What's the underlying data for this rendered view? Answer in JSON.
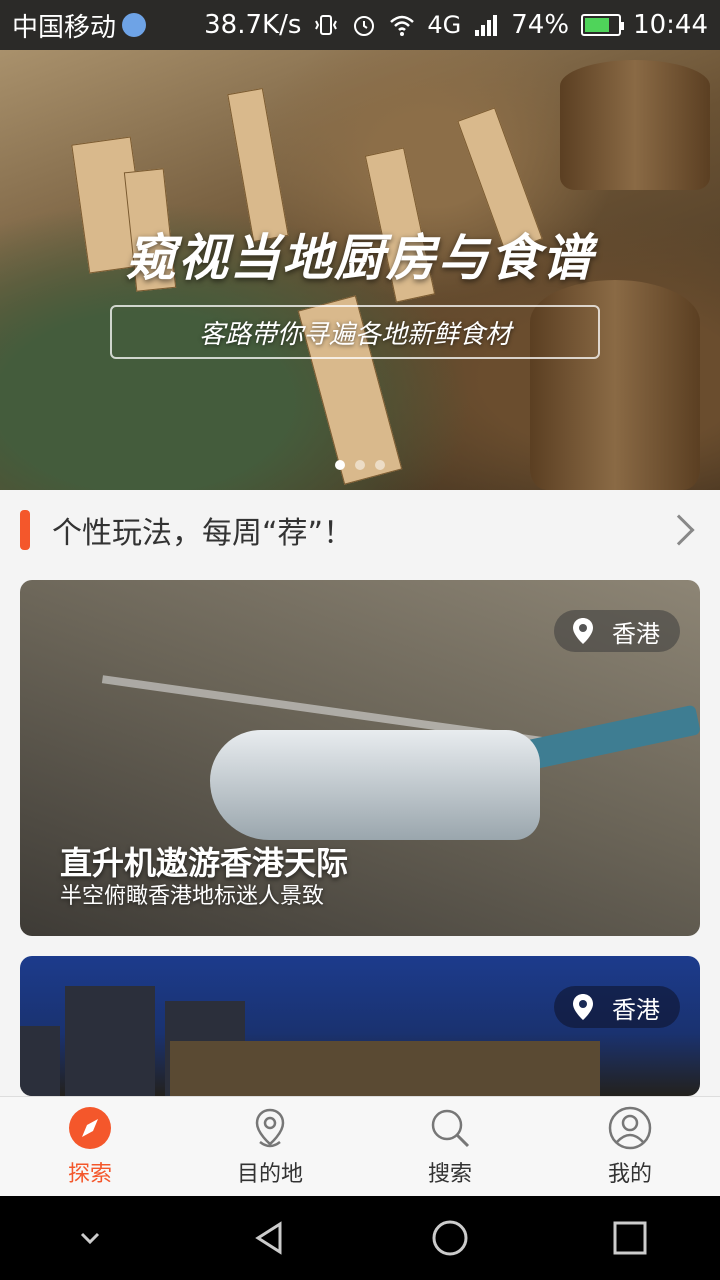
{
  "status_bar": {
    "carrier": "中国移动",
    "net_speed": "38.7K/s",
    "network": "4G",
    "battery": "74%",
    "battery_level": 0.74,
    "time": "10:44"
  },
  "banner": {
    "title": "窥视当地厨房与食谱",
    "subtitle": "客路带你寻遍各地新鲜食材",
    "page_count": 3,
    "active_page": 0
  },
  "section": {
    "title": "个性玩法，每周“荐”！"
  },
  "cards": [
    {
      "location": "香港",
      "title": "直升机遨游香港天际",
      "subtitle": "半空俯瞰香港地标迷人景致"
    },
    {
      "location": "香港"
    }
  ],
  "bottom_nav": {
    "items": [
      {
        "label": "探索",
        "icon": "compass-icon",
        "active": true
      },
      {
        "label": "目的地",
        "icon": "location-pin-icon",
        "active": false
      },
      {
        "label": "搜索",
        "icon": "search-icon",
        "active": false
      },
      {
        "label": "我的",
        "icon": "user-icon",
        "active": false
      }
    ]
  },
  "colors": {
    "accent": "#f4572b",
    "statusbar": "#2b2a28"
  }
}
